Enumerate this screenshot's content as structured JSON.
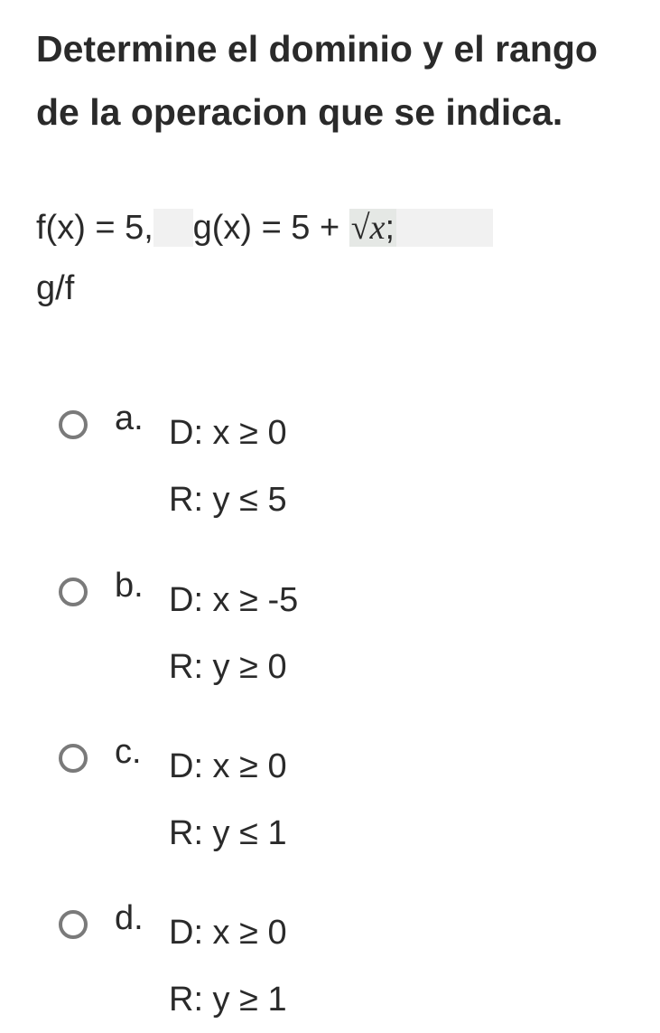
{
  "title": "Determine el dominio y el rango de la operacion que se indica.",
  "equation": {
    "part1": "f(x) = 5,",
    "part2": "g(x) = 5 + ",
    "sqrt": "√x",
    "semicolon": ";",
    "line2": "g/f"
  },
  "options": [
    {
      "letter": "a.",
      "domain": "D: x ≥ 0",
      "range": "R: y ≤ 5"
    },
    {
      "letter": "b.",
      "domain": "D: x ≥ -5",
      "range": "R: y ≥ 0"
    },
    {
      "letter": "c.",
      "domain": "D: x ≥ 0",
      "range": "R: y ≤ 1"
    },
    {
      "letter": "d.",
      "domain": "D: x ≥ 0",
      "range": "R: y ≥ 1"
    }
  ]
}
